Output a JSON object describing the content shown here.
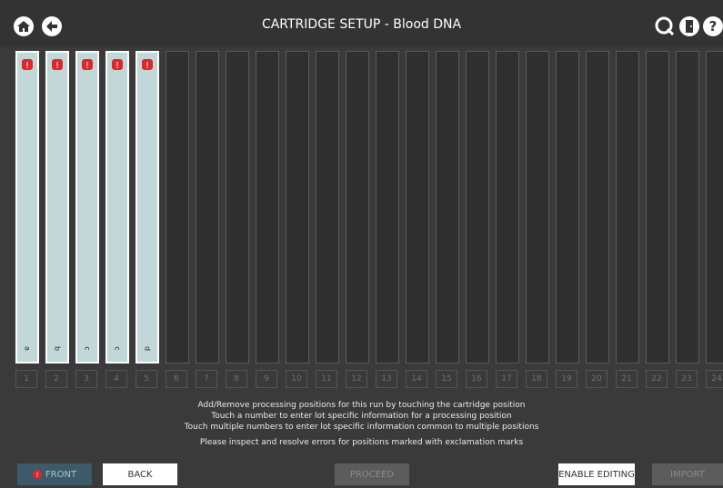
{
  "header": {
    "title": "CARTRIDGE SETUP - Blood DNA"
  },
  "slots": [
    {
      "label": "a",
      "active": true
    },
    {
      "label": "b",
      "active": true
    },
    {
      "label": "c",
      "active": true
    },
    {
      "label": "c",
      "active": true
    },
    {
      "label": "d",
      "active": true
    }
  ],
  "positions": [
    "1",
    "2",
    "3",
    "4",
    "5",
    "6",
    "7",
    "8",
    "9",
    "10",
    "11",
    "12",
    "13",
    "14",
    "15",
    "16",
    "17",
    "18",
    "19",
    "20",
    "21",
    "22",
    "23",
    "24"
  ],
  "instructions": {
    "line1": "Add/Remove processing positions for this run by touching the cartridge position",
    "line2": "Touch a number to enter lot specific information for a processing position",
    "line3": "Touch multiple numbers to enter lot specific information common to multiple positions",
    "line4": "Please inspect and resolve errors for positions marked with exclamation marks"
  },
  "buttons": {
    "front": "FRONT",
    "back": "BACK",
    "proceed": "PROCEED",
    "enable_editing": "ENABLE EDITING",
    "import": "IMPORT"
  },
  "colors": {
    "background": "#3a3a3a",
    "active_slot": "#c2d7d7",
    "warning": "#e0262d"
  },
  "icons": {
    "home": "home-icon",
    "back": "arrow-left-icon",
    "scan": "search-scan-icon",
    "door": "door-icon",
    "help": "help-icon"
  }
}
